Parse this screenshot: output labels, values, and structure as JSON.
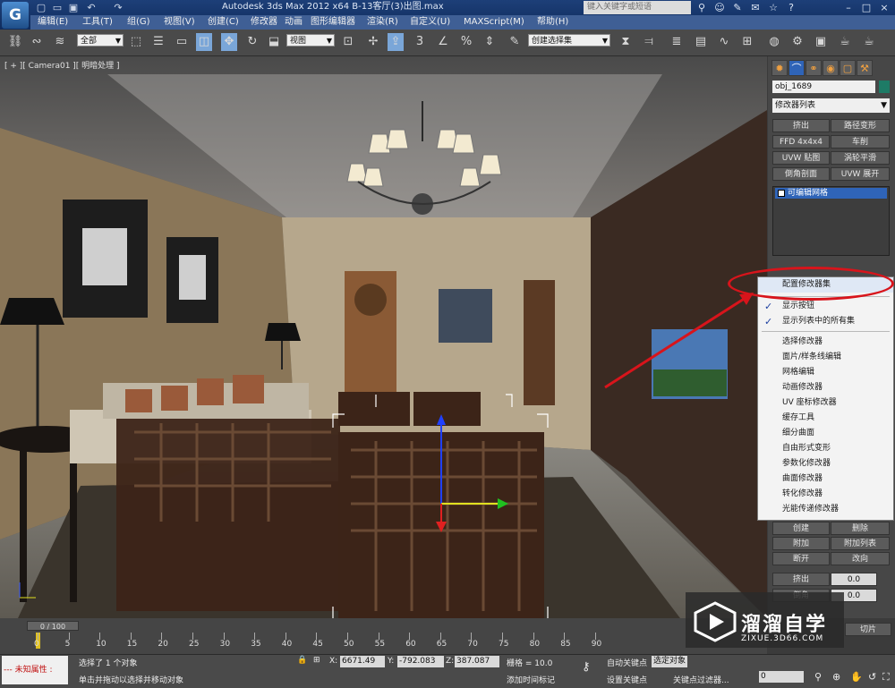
{
  "titlebar": {
    "app_title": "Autodesk 3ds Max  2012 x64      B-13客厅(3)出图.max",
    "search_placeholder": "键入关键字或短语"
  },
  "menubar": [
    "编辑(E)",
    "工具(T)",
    "组(G)",
    "视图(V)",
    "创建(C)",
    "修改器",
    "动画",
    "图形编辑器",
    "渲染(R)",
    "自定义(U)",
    "MAXScript(M)",
    "帮助(H)"
  ],
  "toolbar": {
    "selection_filter": "全部",
    "ref_coord": "视图",
    "named_selection": "创建选择集",
    "snap_label": "3"
  },
  "viewport": {
    "label": "[ + ][ Camera01 ][ 明暗处理 ]"
  },
  "command_panel": {
    "object_name": "obj_1689",
    "object_color": "#1e7b66",
    "modifier_list": "修改器列表",
    "buttons": [
      "挤出",
      "路径变形",
      "FFD 4x4x4",
      "车削",
      "UVW 贴图",
      "涡轮平滑",
      "倒角剖面",
      "UVW 展开"
    ],
    "stack_item": "可编辑网格",
    "lower_buttons": [
      "创建",
      "删除",
      "附加",
      "附加列表",
      "断开",
      "改向",
      "挤出",
      "0.0",
      "倒角",
      "0.0",
      "切片",
      "切片"
    ]
  },
  "context_menu": {
    "items": [
      {
        "label": "配置修改器集",
        "checked": false
      },
      {
        "label": "显示按钮",
        "checked": true
      },
      {
        "label": "显示列表中的所有集",
        "checked": true
      },
      {
        "label": "选择修改器",
        "checked": false
      },
      {
        "label": "面片/样条线编辑",
        "checked": false
      },
      {
        "label": "网格编辑",
        "checked": false
      },
      {
        "label": "动画修改器",
        "checked": false
      },
      {
        "label": "UV 座标修改器",
        "checked": false
      },
      {
        "label": "缓存工具",
        "checked": false
      },
      {
        "label": "细分曲面",
        "checked": false
      },
      {
        "label": "自由形式变形",
        "checked": false
      },
      {
        "label": "参数化修改器",
        "checked": false
      },
      {
        "label": "曲面修改器",
        "checked": false
      },
      {
        "label": "转化修改器",
        "checked": false
      },
      {
        "label": "光能传递修改器",
        "checked": false
      }
    ],
    "highlight_color": "#d8141b"
  },
  "timeline": {
    "frame_slider": "0 / 100",
    "ticks": [
      "0",
      "5",
      "10",
      "15",
      "20",
      "25",
      "30",
      "35",
      "40",
      "45",
      "50",
      "55",
      "60",
      "65",
      "70",
      "75",
      "80",
      "85",
      "90"
    ]
  },
  "statusbar": {
    "unknown_prop": "--- 未知属性 : ",
    "selected_msg": "选择了 1 个对象",
    "prompt": "单击并拖动以选择并移动对象",
    "x_label": "X:",
    "x_value": "6671.49",
    "y_label": "Y:",
    "y_value": "-792.083",
    "z_label": "Z:",
    "z_value": "387.087",
    "grid": "栅格 = 10.0",
    "add_time_tag": "添加时间标记",
    "auto_key": "自动关键点",
    "set_key": "设置关键点",
    "selected_obj": "选定对象",
    "key_filters": "关键点过滤器...",
    "frame_value": "0"
  },
  "watermark": {
    "title": "溜溜自学",
    "url": "ZIXUE.3D66.COM"
  }
}
